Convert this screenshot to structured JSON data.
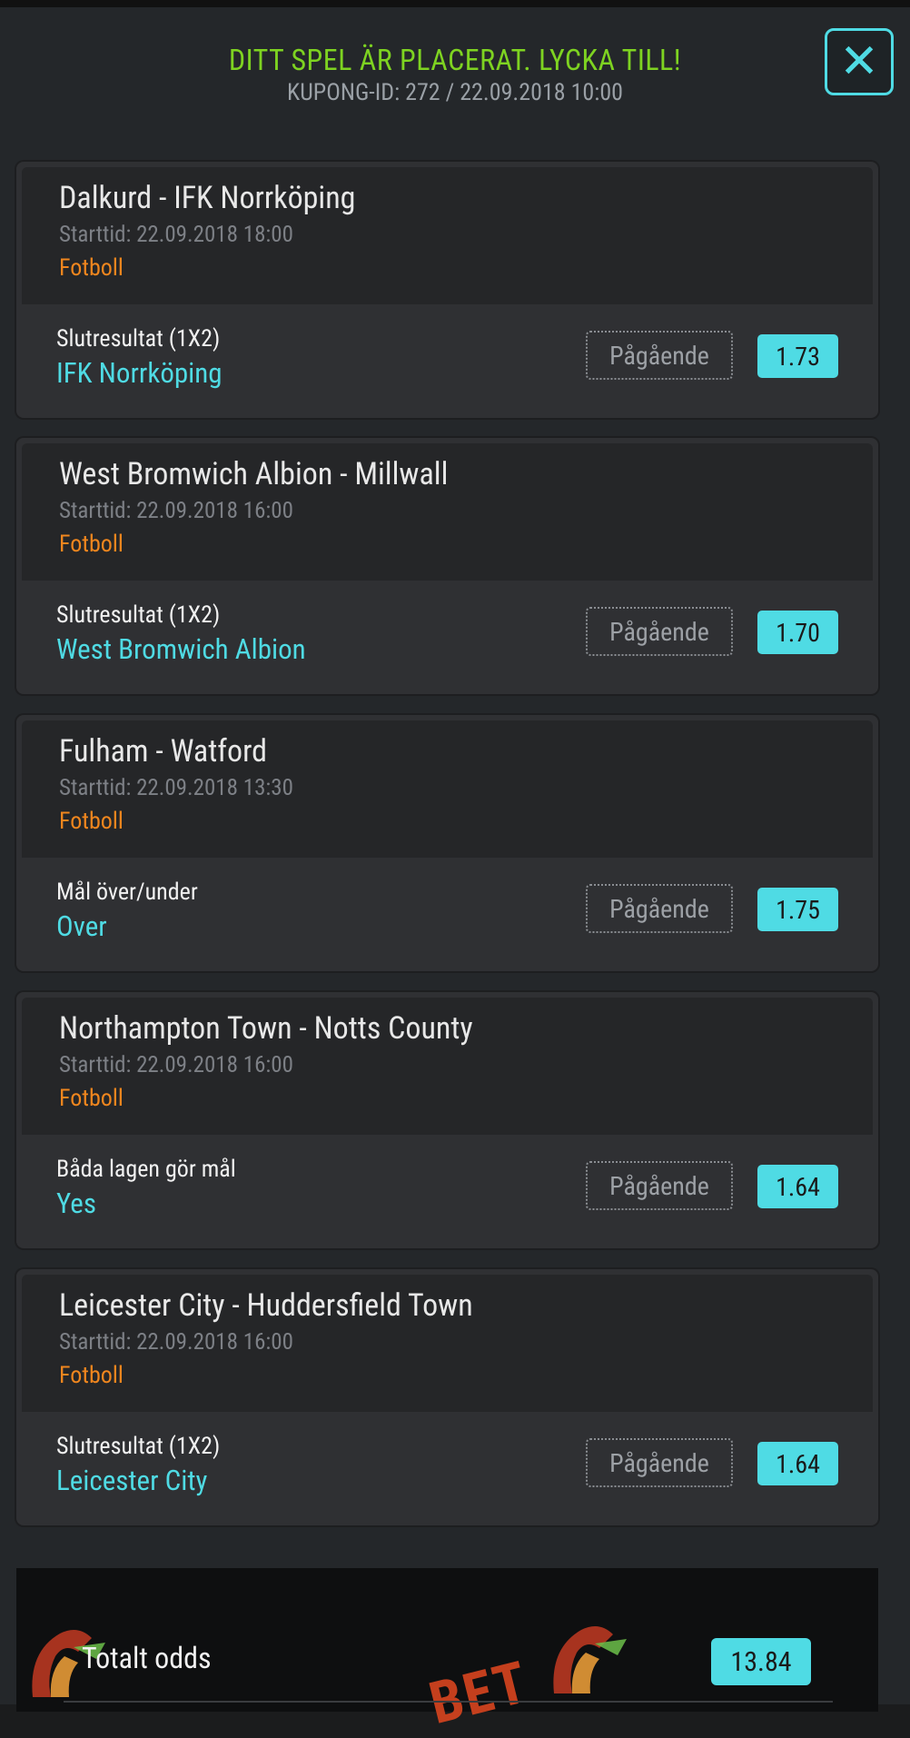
{
  "header": {
    "title": "DITT SPEL ÄR PLACERAT. LYCKA TILL!",
    "subtitle": "KUPONG-ID: 272 / 22.09.2018 10:00",
    "close_symbol": "✕"
  },
  "bets": [
    {
      "match": "Dalkurd - IFK Norrköping",
      "start": "Starttid: 22.09.2018 18:00",
      "sport": "Fotboll",
      "market": "Slutresultat (1X2)",
      "pick": "IFK Norrköping",
      "status": "Pågående",
      "odds": "1.73"
    },
    {
      "match": "West Bromwich Albion - Millwall",
      "start": "Starttid: 22.09.2018 16:00",
      "sport": "Fotboll",
      "market": "Slutresultat (1X2)",
      "pick": "West Bromwich Albion",
      "status": "Pågående",
      "odds": "1.70"
    },
    {
      "match": "Fulham - Watford",
      "start": "Starttid: 22.09.2018 13:30",
      "sport": "Fotboll",
      "market": "Mål över/under",
      "pick": "Over",
      "status": "Pågående",
      "odds": "1.75"
    },
    {
      "match": "Northampton Town - Notts County",
      "start": "Starttid: 22.09.2018 16:00",
      "sport": "Fotboll",
      "market": "Båda lagen gör mål",
      "pick": "Yes",
      "status": "Pågående",
      "odds": "1.64"
    },
    {
      "match": "Leicester City - Huddersfield Town",
      "start": "Starttid: 22.09.2018 16:00",
      "sport": "Fotboll",
      "market": "Slutresultat (1X2)",
      "pick": "Leicester City",
      "status": "Pågående",
      "odds": "1.64"
    }
  ],
  "total": {
    "label": "Totalt odds",
    "value": "13.84",
    "watermark_text": "BET"
  },
  "colors": {
    "accent": "#4fdbe4",
    "success": "#7ed321",
    "sport": "#f0861e"
  }
}
